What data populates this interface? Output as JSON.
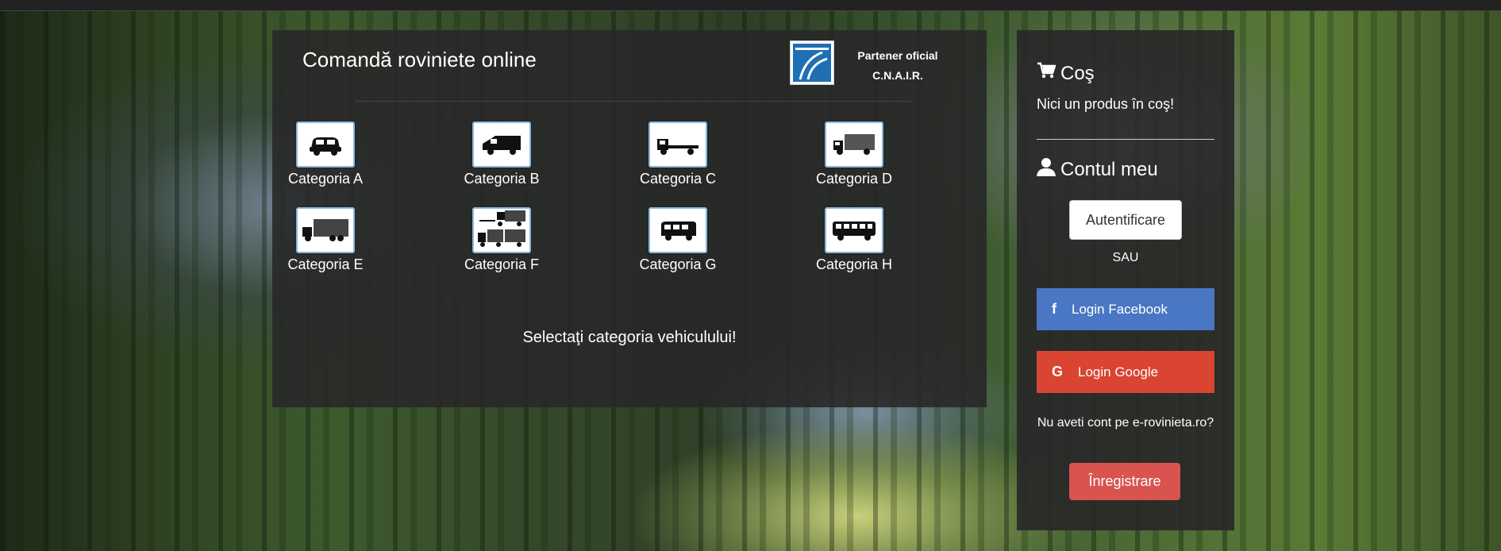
{
  "main": {
    "title": "Comandă roviniete online",
    "partner_line1": "Partener oficial",
    "partner_line2": "C.N.A.I.R.",
    "categories": [
      {
        "label": "Categoria A",
        "icon": "car-icon"
      },
      {
        "label": "Categoria B",
        "icon": "van-icon"
      },
      {
        "label": "Categoria C",
        "icon": "flatbed-truck-icon"
      },
      {
        "label": "Categoria D",
        "icon": "box-truck-icon"
      },
      {
        "label": "Categoria E",
        "icon": "large-truck-icon"
      },
      {
        "label": "Categoria F",
        "icon": "truck-trailer-icon"
      },
      {
        "label": "Categoria G",
        "icon": "minibus-icon"
      },
      {
        "label": "Categoria H",
        "icon": "bus-icon"
      }
    ],
    "select_message": "Selectaţi categoria vehiculului!"
  },
  "sidebar": {
    "cart_title": "Coş",
    "cart_empty": "Nici un produs în coş!",
    "account_title": "Contul meu",
    "login_label": "Autentificare",
    "or_label": "SAU",
    "facebook_label": "Login Facebook",
    "google_label": "Login Google",
    "no_account": "Nu aveti cont pe e-rovinieta.ro?",
    "register_label": "Înregistrare"
  },
  "colors": {
    "facebook": "#4a77c3",
    "google": "#d94433",
    "register": "#d9534f"
  }
}
